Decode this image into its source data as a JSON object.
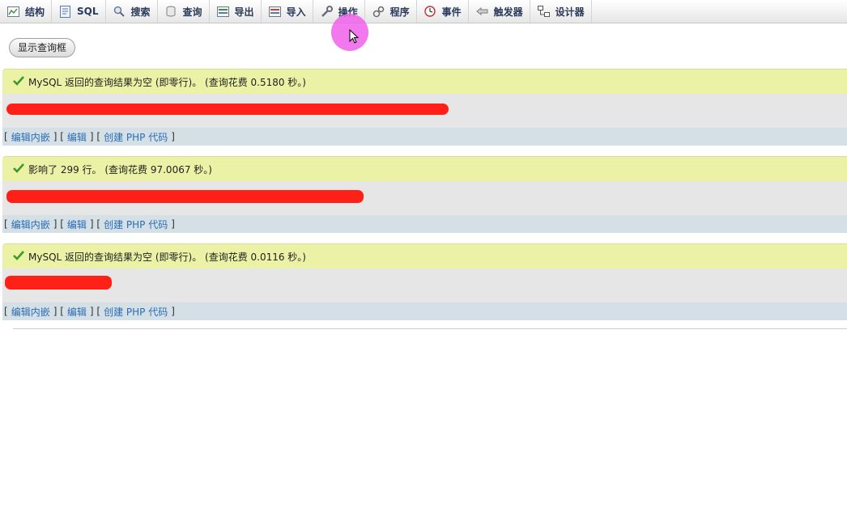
{
  "tabs": [
    {
      "label": "结构",
      "icon": "structure-icon"
    },
    {
      "label": "SQL",
      "icon": "sql-document-icon"
    },
    {
      "label": "搜索",
      "icon": "search-icon"
    },
    {
      "label": "查询",
      "icon": "query-icon"
    },
    {
      "label": "导出",
      "icon": "export-icon"
    },
    {
      "label": "导入",
      "icon": "import-icon"
    },
    {
      "label": "操作",
      "icon": "wrench-icon"
    },
    {
      "label": "程序",
      "icon": "routines-icon"
    },
    {
      "label": "事件",
      "icon": "clock-icon"
    },
    {
      "label": "触发器",
      "icon": "trigger-icon"
    },
    {
      "label": "设计器",
      "icon": "designer-icon"
    }
  ],
  "toggle_button": "显示查询框",
  "results": [
    {
      "message": "MySQL 返回的查询结果为空 (即零行)。 (查询花费 0.5180 秒。)",
      "links": {
        "inline_edit": "编辑内嵌",
        "edit": "编辑",
        "create_php": "创建 PHP 代码"
      }
    },
    {
      "message": "影响了 299 行。 (查询花费 97.0067 秒。)",
      "links": {
        "inline_edit": "编辑内嵌",
        "edit": "编辑",
        "create_php": "创建 PHP 代码"
      }
    },
    {
      "message": "MySQL 返回的查询结果为空 (即零行)。 (查询花费 0.0116 秒。)",
      "links": {
        "inline_edit": "编辑内嵌",
        "edit": "编辑",
        "create_php": "创建 PHP 代码"
      }
    }
  ],
  "colors": {
    "success_bg": "#ebf2a6",
    "sql_bg": "#e6e6e6",
    "links_bg": "#d4dfe6",
    "redaction": "#ff2018",
    "cursor_highlight": "#ee60ea"
  }
}
